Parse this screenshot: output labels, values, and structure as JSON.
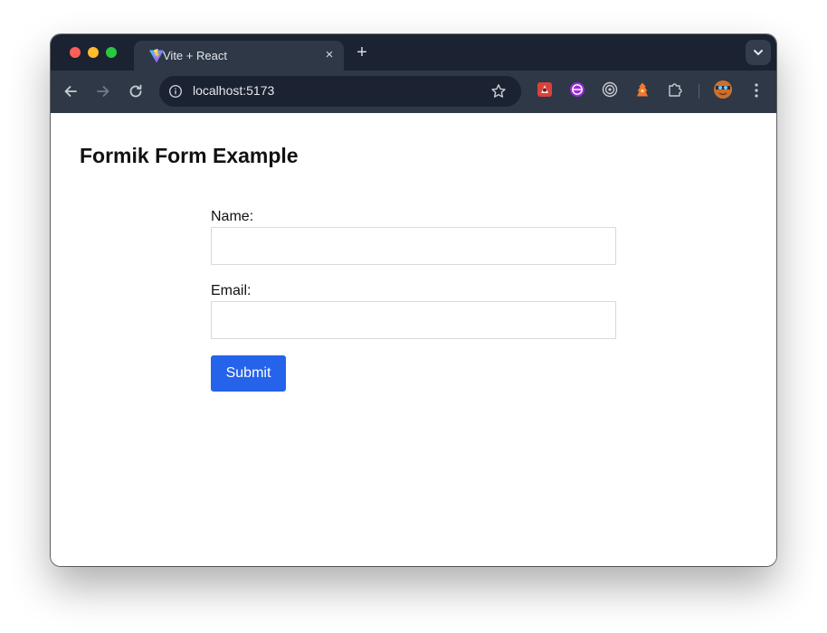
{
  "browser": {
    "tab": {
      "title": "Vite + React",
      "favicon": "vite-logo-icon",
      "close_icon": "×"
    },
    "new_tab_icon": "+",
    "address_bar": {
      "url": "localhost:5173",
      "info_icon": "info-icon",
      "bookmark_icon": "star-icon"
    },
    "nav": {
      "back_icon": "arrow-left-icon",
      "forward_icon": "arrow-right-icon",
      "reload_icon": "reload-icon"
    },
    "extensions": [
      "extension-red-icon",
      "extension-purple-icon",
      "extension-target-icon",
      "extension-orange-icon",
      "puzzle-icon"
    ],
    "colors": {
      "tabstrip": "#1b2231",
      "toolbar": "#2f3847",
      "close_red": "#fe5f57",
      "minimize_yellow": "#febc2e",
      "zoom_green": "#28c840"
    }
  },
  "page": {
    "title": "Formik Form Example",
    "form": {
      "name_label": "Name:",
      "name_value": "",
      "email_label": "Email:",
      "email_value": "",
      "submit_label": "Submit"
    },
    "accent_color": "#2563eb"
  }
}
